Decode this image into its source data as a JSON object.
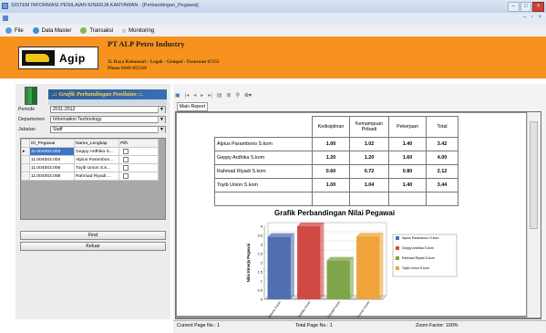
{
  "window": {
    "title": "SISTEM INFORMASI PENILAIAN KINERJA KARYAWAN - [Perbandingan_Pegawai]"
  },
  "menu": [
    {
      "label": "File",
      "icon": "file-icon",
      "color": "#5b9bd5"
    },
    {
      "label": "Data Master",
      "icon": "data-master-icon",
      "color": "#3c8dde"
    },
    {
      "label": "Transaksi",
      "icon": "transaksi-icon",
      "color": "#8ab45a"
    },
    {
      "label": "Monitoring",
      "icon": "monitoring-icon",
      "color": "#9aa0a8"
    }
  ],
  "header": {
    "company": "PT ALP Petro Industry",
    "address1": "Jl. Raya Kebonsari - Legok - Gempol - Pasuruan 67155",
    "phone": "Phone 0343-855310",
    "logo_text": "Agip",
    "bg_color": "#f7921e"
  },
  "left": {
    "title": ".:: Grafik Perbandingan Penilaian ::.",
    "periode_label": "Periode",
    "periode_value": "2011-2012",
    "departemen_label": "Departemen",
    "departemen_value": "Information Technology",
    "jabatan_label": "Jabatan",
    "jabatan_value": "Staff",
    "grid": {
      "headers": [
        "ID_Pegawai",
        "Nama_Lengkap",
        "Pilh"
      ],
      "rows": [
        {
          "id": "11.004003.003",
          "nama": "Geppy Ardhika S..."
        },
        {
          "id": "11.004003.004",
          "nama": "Alpius Parambon..."
        },
        {
          "id": "11.004003.006",
          "nama": "Toyib Union S.k..."
        },
        {
          "id": "11.004003.008",
          "nama": "Rahmad Riyadi ..."
        }
      ]
    },
    "find_label": "Find",
    "keluar_label": "Keluar"
  },
  "viewer": {
    "tab_label": "Main Report",
    "toolbar_icons": [
      "export-icon",
      "first-page-icon",
      "prev-page-icon",
      "next-page-icon",
      "last-page-icon",
      "goto-page-icon",
      "close-icon",
      "search-icon",
      "zoom-icon"
    ],
    "table": {
      "headers": [
        "Kedisiplinan",
        "Kemampuan Pribadi",
        "Pekerjaan",
        "Total"
      ],
      "rows": [
        {
          "name": "Alpius Parambono S.kom",
          "values": [
            "1.00",
            "1.02",
            "1.40",
            "3.42"
          ]
        },
        {
          "name": "Geppy Ardhika S.kom",
          "values": [
            "1.20",
            "1.20",
            "1.60",
            "4.00"
          ]
        },
        {
          "name": "Rahmad Riyadi S.kom",
          "values": [
            "0.60",
            "0.72",
            "0.80",
            "2.12"
          ]
        },
        {
          "name": "Toyib Union S.kom",
          "values": [
            "1.00",
            "1.04",
            "1.40",
            "3.44"
          ]
        }
      ]
    }
  },
  "chart_data": {
    "type": "bar",
    "title": "Grafik Perbandingan Nilai Pegawai",
    "ylabel": "Nilai Kinerja Pegawai",
    "xlabel": "",
    "ylim": [
      0,
      4
    ],
    "yticks": [
      "0",
      "0.5",
      "1",
      "1.5",
      "2",
      "2.5",
      "3",
      "3.5",
      "4"
    ],
    "categories": [
      "Alpius Parambono S.kom",
      "Geppy Ardhika S.kom",
      "Rahmad Riyadi S.kom",
      "Toyib Union S.kom"
    ],
    "values": [
      3.42,
      4.0,
      2.12,
      3.44
    ],
    "colors": [
      "#4f6fb0",
      "#cf4a45",
      "#7fa54a",
      "#f0a33a"
    ],
    "legend": [
      "Alpius Parambono S.kom",
      "Geppy Ardhika S.kom",
      "Rahmad Riyadi S.kom",
      "Toyib Union S.kom"
    ],
    "legend_position": "right",
    "grid": true
  },
  "status": {
    "current_page": "Current Page No.: 1",
    "total_page": "Total Page No.: 1",
    "zoom": "Zoom Factor: 100%"
  }
}
